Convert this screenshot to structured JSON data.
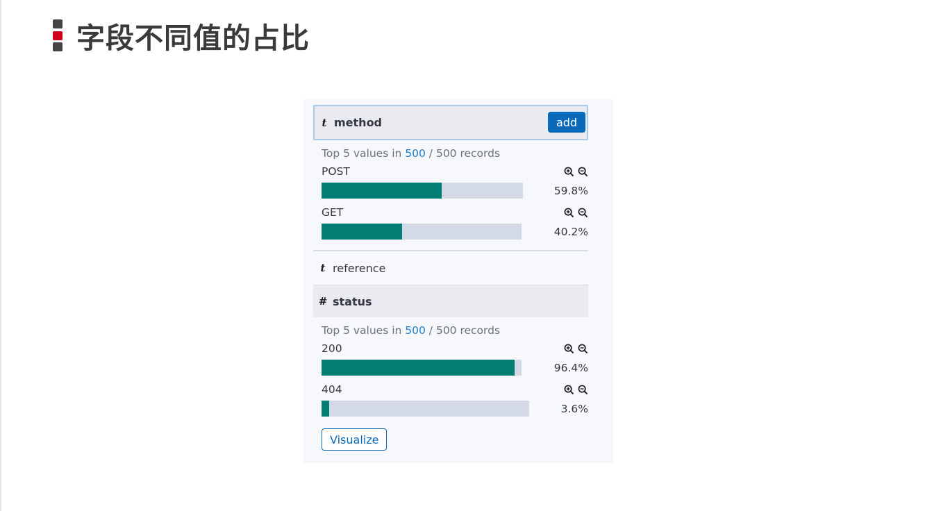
{
  "title": "字段不同值的占比",
  "colors": {
    "marker_top": "#444444",
    "marker_mid": "#d0021b",
    "marker_bottom": "#444444",
    "accent": "#0a69b8",
    "bar_fill": "#017d73",
    "bar_track": "#d3dae6"
  },
  "fields": {
    "method": {
      "type_icon": "t",
      "name": "method",
      "add_label": "add",
      "top_prefix": "Top 5 values in ",
      "top_count": "500",
      "top_suffix": " / 500 records",
      "values": [
        {
          "label": "POST",
          "percent_text": "59.8%",
          "fill": 0.598
        },
        {
          "label": "GET",
          "percent_text": "40.2%",
          "fill": 0.402
        }
      ]
    },
    "reference": {
      "type_icon": "t",
      "name": "reference"
    },
    "status": {
      "type_icon": "#",
      "name": "status",
      "top_prefix": "Top 5 values in ",
      "top_count": "500",
      "top_suffix": " / 500 records",
      "values": [
        {
          "label": "200",
          "percent_text": "96.4%",
          "fill": 0.964
        },
        {
          "label": "404",
          "percent_text": "3.6%",
          "fill": 0.036
        }
      ],
      "visualize_label": "Visualize"
    }
  },
  "icons": {
    "zoom_in": "magnifier-plus-icon",
    "zoom_out": "magnifier-minus-icon"
  }
}
